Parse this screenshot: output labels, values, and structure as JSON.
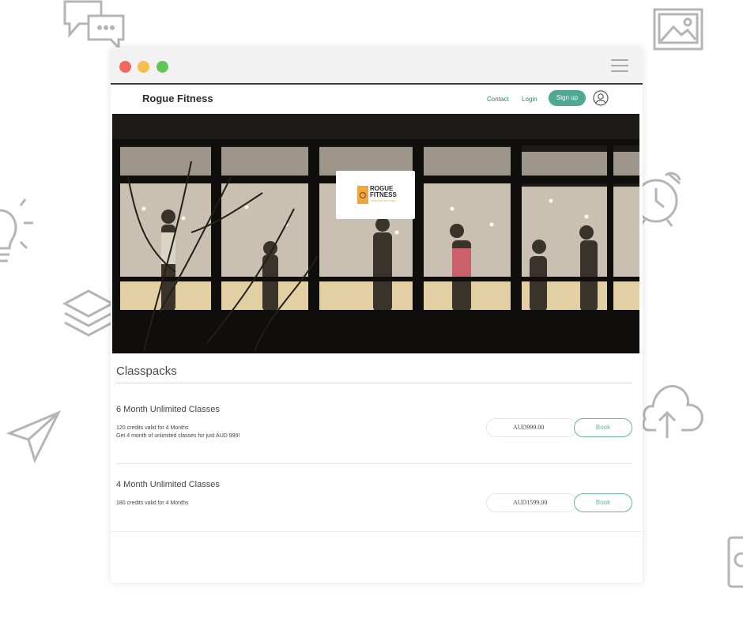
{
  "nav": {
    "brand": "Rogue Fitness",
    "contact": "Contact",
    "login": "Login",
    "signup": "Sign up"
  },
  "hero": {
    "logo_title": "ROGUE FITNESS",
    "logo_subtitle": "YOUR GROUPS HOME"
  },
  "section": {
    "title": "Classpacks"
  },
  "packs": [
    {
      "name": "6 Month Unlimited Classes",
      "line1": "120 credits valid for 4 Months",
      "line2": "Get 4 month of unlimited  classes for just AUD 999!",
      "price": "AUD999.00",
      "book": "Book"
    },
    {
      "name": "4 Month Unlimited Classes",
      "line1": "180 credits valid for 4 Months",
      "line2": "",
      "price": "AUD1599.00",
      "book": "Book"
    }
  ],
  "colors": {
    "accent": "#4ea892",
    "book_outline": "#6ab39f",
    "link": "#2e7d74",
    "traffic_red": "#ee6a5f",
    "traffic_yellow": "#f5be4f",
    "traffic_green": "#62c654"
  }
}
